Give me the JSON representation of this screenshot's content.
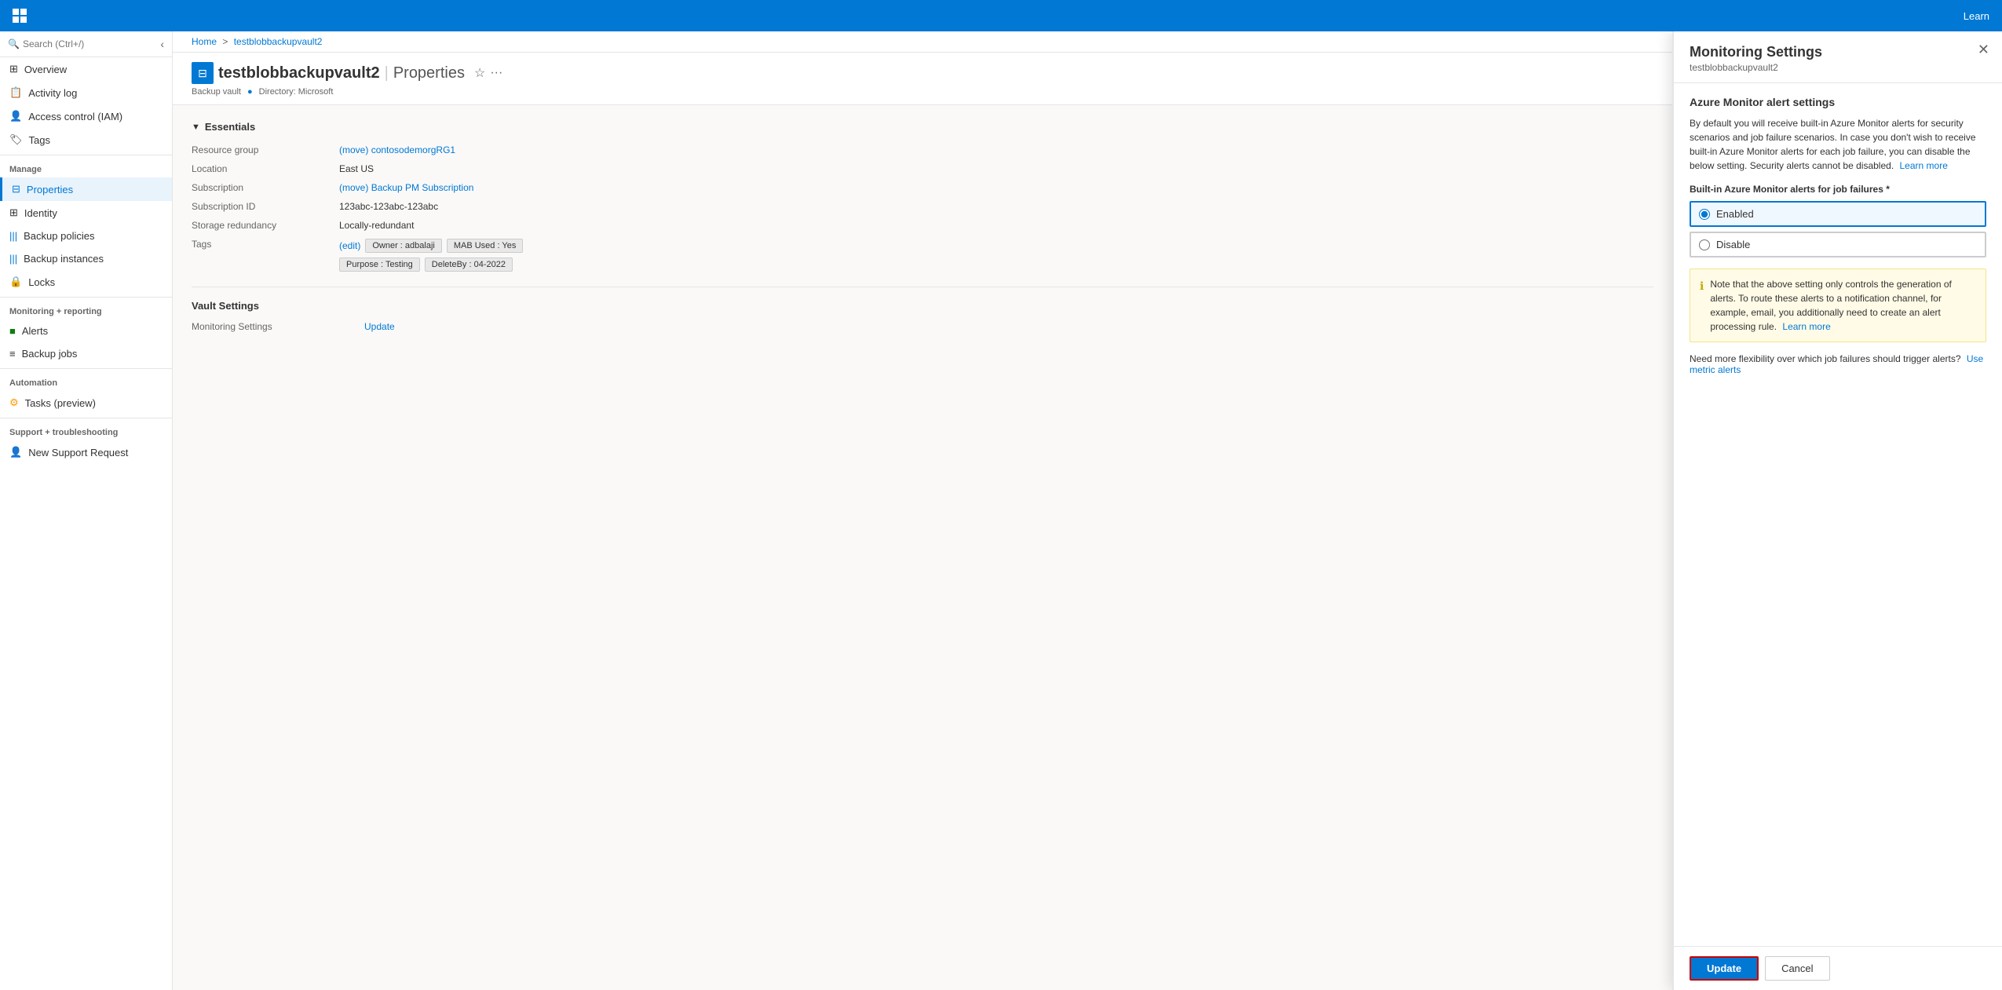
{
  "topbar": {
    "logo_squares": 4,
    "learn_label": "Learn"
  },
  "breadcrumb": {
    "home_label": "Home",
    "sep": ">",
    "current_label": "testblobbackupvault2"
  },
  "page": {
    "title": "testblobbackupvault2",
    "separator": "|",
    "subtitle_left": "Properties",
    "resource_type": "Backup vault",
    "directory_label": "Directory: Microsoft"
  },
  "search": {
    "placeholder": "Search (Ctrl+/)"
  },
  "sidebar": {
    "items": [
      {
        "id": "overview",
        "label": "Overview",
        "icon": "⊞",
        "section": ""
      },
      {
        "id": "activity-log",
        "label": "Activity log",
        "icon": "≡",
        "section": ""
      },
      {
        "id": "access-control",
        "label": "Access control (IAM)",
        "icon": "👤",
        "section": ""
      },
      {
        "id": "tags",
        "label": "Tags",
        "icon": "🏷",
        "section": ""
      },
      {
        "id": "manage-section",
        "label": "Manage",
        "section_header": true
      },
      {
        "id": "properties",
        "label": "Properties",
        "icon": "⊟",
        "section": "manage",
        "active": true
      },
      {
        "id": "identity",
        "label": "Identity",
        "icon": "⊞",
        "section": "manage"
      },
      {
        "id": "backup-policies",
        "label": "Backup policies",
        "icon": "|||",
        "section": "manage"
      },
      {
        "id": "backup-instances",
        "label": "Backup instances",
        "icon": "|||",
        "section": "manage"
      },
      {
        "id": "locks",
        "label": "Locks",
        "icon": "🔒",
        "section": "manage"
      },
      {
        "id": "monitoring-section",
        "label": "Monitoring + reporting",
        "section_header": true
      },
      {
        "id": "alerts",
        "label": "Alerts",
        "icon": "■",
        "section": "monitoring"
      },
      {
        "id": "backup-jobs",
        "label": "Backup jobs",
        "icon": "≡",
        "section": "monitoring"
      },
      {
        "id": "automation-section",
        "label": "Automation",
        "section_header": true
      },
      {
        "id": "tasks-preview",
        "label": "Tasks (preview)",
        "icon": "⚙",
        "section": "automation"
      },
      {
        "id": "support-section",
        "label": "Support + troubleshooting",
        "section_header": true
      },
      {
        "id": "new-support-request",
        "label": "New Support Request",
        "icon": "👤",
        "section": "support"
      }
    ]
  },
  "essentials": {
    "section_title": "Essentials",
    "rows": [
      {
        "label": "Resource group",
        "value": "contosodemorgRG1",
        "link": true,
        "extra": "(move)"
      },
      {
        "label": "Location",
        "value": "East US",
        "link": false
      },
      {
        "label": "Subscription",
        "value": "Backup PM Subscription",
        "link": true,
        "extra": "(move)"
      },
      {
        "label": "Subscription ID",
        "value": "123abc-123abc-123abc",
        "link": false
      },
      {
        "label": "Storage redundancy",
        "value": "Locally-redundant",
        "link": false
      }
    ],
    "tags_label": "Tags",
    "tags_edit": "(edit)",
    "tags": [
      "Owner : adbalaji",
      "MAB Used : Yes",
      "Purpose : Testing",
      "DeleteBy : 04-2022"
    ]
  },
  "vault_settings": {
    "section_title": "Vault Settings",
    "monitoring_label": "Monitoring Settings",
    "monitoring_link": "Update"
  },
  "panel": {
    "title": "Monitoring Settings",
    "subtitle": "testblobbackupvault2",
    "section_title": "Azure Monitor alert settings",
    "description": "By default you will receive built-in Azure Monitor alerts for security scenarios and job failure scenarios. In case you don't wish to receive built-in Azure Monitor alerts for each job failure, you can disable the below setting. Security alerts cannot be disabled.",
    "learn_more_label": "Learn more",
    "radio_group_label": "Built-in Azure Monitor alerts for job failures *",
    "radio_options": [
      {
        "id": "enabled",
        "label": "Enabled",
        "selected": true
      },
      {
        "id": "disable",
        "label": "Disable",
        "selected": false
      }
    ],
    "info_text": "Note that the above setting only controls the generation of alerts. To route these alerts to a notification channel, for example, email, you additionally need to create an alert processing rule.",
    "info_learn_more": "Learn more",
    "metric_text": "Need more flexibility over which job failures should trigger alerts?",
    "metric_link_label": "Use metric alerts",
    "update_btn": "Update",
    "cancel_btn": "Cancel"
  }
}
